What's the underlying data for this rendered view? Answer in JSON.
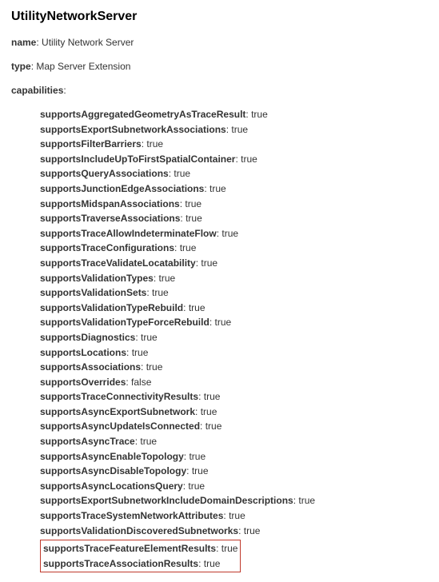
{
  "title": "UtilityNetworkServer",
  "name_label": "name",
  "name_value": "Utility Network Server",
  "type_label": "type",
  "type_value": "Map Server Extension",
  "capabilities_label": "capabilities",
  "caps": [
    {
      "key": "supportsAggregatedGeometryAsTraceResult",
      "value": "true"
    },
    {
      "key": "supportsExportSubnetworkAssociations",
      "value": "true"
    },
    {
      "key": "supportsFilterBarriers",
      "value": "true"
    },
    {
      "key": "supportsIncludeUpToFirstSpatialContainer",
      "value": "true"
    },
    {
      "key": "supportsQueryAssociations",
      "value": "true"
    },
    {
      "key": "supportsJunctionEdgeAssociations",
      "value": "true"
    },
    {
      "key": "supportsMidspanAssociations",
      "value": "true"
    },
    {
      "key": "supportsTraverseAssociations",
      "value": "true"
    },
    {
      "key": "supportsTraceAllowIndeterminateFlow",
      "value": "true"
    },
    {
      "key": "supportsTraceConfigurations",
      "value": "true"
    },
    {
      "key": "supportsTraceValidateLocatability",
      "value": "true"
    },
    {
      "key": "supportsValidationTypes",
      "value": "true"
    },
    {
      "key": "supportsValidationSets",
      "value": "true"
    },
    {
      "key": "supportsValidationTypeRebuild",
      "value": "true"
    },
    {
      "key": "supportsValidationTypeForceRebuild",
      "value": "true"
    },
    {
      "key": "supportsDiagnostics",
      "value": "true"
    },
    {
      "key": "supportsLocations",
      "value": "true"
    },
    {
      "key": "supportsAssociations",
      "value": "true"
    },
    {
      "key": "supportsOverrides",
      "value": "false"
    },
    {
      "key": "supportsTraceConnectivityResults",
      "value": "true"
    },
    {
      "key": "supportsAsyncExportSubnetwork",
      "value": "true"
    },
    {
      "key": "supportsAsyncUpdateIsConnected",
      "value": "true"
    },
    {
      "key": "supportsAsyncTrace",
      "value": "true"
    },
    {
      "key": "supportsAsyncEnableTopology",
      "value": "true"
    },
    {
      "key": "supportsAsyncDisableTopology",
      "value": "true"
    },
    {
      "key": "supportsAsyncLocationsQuery",
      "value": "true"
    },
    {
      "key": "supportsExportSubnetworkIncludeDomainDescriptions",
      "value": "true"
    },
    {
      "key": "supportsTraceSystemNetworkAttributes",
      "value": "true"
    },
    {
      "key": "supportsValidationDiscoveredSubnetworks",
      "value": "true"
    }
  ],
  "highlighted_caps": [
    {
      "key": "supportsTraceFeatureElementResults",
      "value": "true"
    },
    {
      "key": "supportsTraceAssociationResults",
      "value": "true"
    }
  ]
}
